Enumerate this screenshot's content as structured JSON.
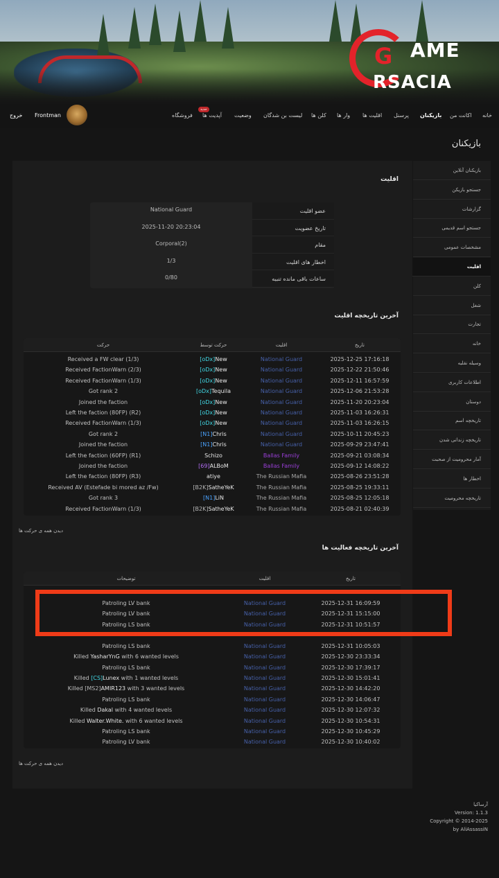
{
  "brand": {
    "logo_line1": "AME",
    "logo_line2": "RSACIA",
    "logo_mark": "G"
  },
  "nav": {
    "items": [
      "خانه",
      "اکانت من",
      "بازیکنان",
      "پرسنل",
      "اقلیت ها",
      "وار ها",
      "کلن ها",
      "لیست بن شدگان",
      "وضعیت",
      "آپدیت ها",
      "فروشگاه"
    ],
    "active": "بازیکنان",
    "badge": "جدید",
    "username": "Frontman",
    "logout": "خروج"
  },
  "page_title": "بازیکنان",
  "sidebar": {
    "items": [
      "بازیکنان آنلاین",
      "جستجو بازیکن",
      "گزارشات",
      "جستجو اسم قدیمی",
      "مشخصات عمومی",
      "اقلیت",
      "کلن",
      "شغل",
      "تجارت",
      "خانه",
      "وسیله نقلیه",
      "اطلاعات کاربری",
      "دوستان",
      "تاریخچه اسم",
      "تاریخچه زندانی شدن",
      "آمار محرومیت از صحبت",
      "اخطار ها",
      "تاریخچه محرومیت"
    ],
    "active_index": 5
  },
  "faction": {
    "title": "اقلیت",
    "rows": [
      {
        "label": "عضو اقلیت",
        "value": "National Guard"
      },
      {
        "label": "تاریخ عضویت",
        "value": "2025-11-20 20:23:04"
      },
      {
        "label": "مقام",
        "value": "Corporal(2)"
      },
      {
        "label": "اخطار های اقلیت",
        "value": "1/3"
      },
      {
        "label": "ساعات باقی مانده تنبیه",
        "value": "0/80"
      }
    ]
  },
  "faction_history": {
    "title": "آخرین تاریخچه اقلیت",
    "headers": {
      "date": "تاریخ",
      "faction": "اقلیت",
      "by": "حرکت توسط",
      "action": "حرکت"
    },
    "rows": [
      {
        "date": "2025-12-25 17:16:18",
        "faction": "National Guard",
        "tag": "[oDx]",
        "name": "New",
        "action": "Received a FW clear (1/3)"
      },
      {
        "date": "2025-12-22 21:50:46",
        "faction": "National Guard",
        "tag": "[oDx]",
        "name": "New",
        "action": "Received FactionWarn (2/3)"
      },
      {
        "date": "2025-12-11 16:57:59",
        "faction": "National Guard",
        "tag": "[oDx]",
        "name": "New",
        "action": "Received FactionWarn (1/3)"
      },
      {
        "date": "2025-12-06 21:53:28",
        "faction": "National Guard",
        "tag": "[oDx]",
        "name": "Tequila",
        "action": "Got rank 2"
      },
      {
        "date": "2025-11-20 20:23:04",
        "faction": "National Guard",
        "tag": "[oDx]",
        "name": "New",
        "action": "Joined the faction"
      },
      {
        "date": "2025-11-03 16:26:31",
        "faction": "National Guard",
        "tag": "[oDx]",
        "name": "New",
        "action": "Left the faction (80FP) (R2)"
      },
      {
        "date": "2025-11-03 16:26:15",
        "faction": "National Guard",
        "tag": "[oDx]",
        "name": "New",
        "action": "Received FactionWarn (1/3)"
      },
      {
        "date": "2025-10-11 20:45:23",
        "faction": "National Guard",
        "tag": "[N1]",
        "name": "Chris",
        "action": "Got rank 2"
      },
      {
        "date": "2025-09-29 23:47:41",
        "faction": "National Guard",
        "tag": "[N1]",
        "name": "Chris",
        "action": "Joined the faction"
      },
      {
        "date": "2025-09-21 03:08:34",
        "faction": "Ballas Family",
        "tag": "",
        "name": "Schizo",
        "action": "Left the faction (60FP) (R1)"
      },
      {
        "date": "2025-09-12 14:08:22",
        "faction": "Ballas Family",
        "tag": "[69]",
        "name": "ALBoM",
        "action": "Joined the faction"
      },
      {
        "date": "2025-08-26 23:51:28",
        "faction": "The Russian Mafia",
        "tag": "",
        "name": "atiye",
        "action": "Left the faction (80FP) (R3)"
      },
      {
        "date": "2025-08-25 19:33:11",
        "faction": "The Russian Mafia",
        "tag": "[B2K]",
        "name": "SatheYeK",
        "action": "Received AV (Estefade bi mored az /Fw)"
      },
      {
        "date": "2025-08-25 12:05:18",
        "faction": "The Russian Mafia",
        "tag": "[N1]",
        "name": "LiN",
        "action": "Got rank 3"
      },
      {
        "date": "2025-08-21 02:40:39",
        "faction": "The Russian Mafia",
        "tag": "[B2K]",
        "name": "SatheYeK",
        "action": "Received FactionWarn (1/3)"
      }
    ],
    "view_all": "دیدن همه ی حرکت ها"
  },
  "activity_history": {
    "title": "آخرین تاریخچه فعالیت ها",
    "headers": {
      "date": "تاریخ",
      "faction": "اقلیت",
      "desc": "توضیحات"
    },
    "rows": [
      {
        "date": "2025-12-31 16:09:59",
        "faction": "National Guard",
        "pre": "",
        "tag": "",
        "name": "",
        "post": "Patroling LV bank"
      },
      {
        "date": "2025-12-31 15:15:00",
        "faction": "National Guard",
        "pre": "",
        "tag": "",
        "name": "",
        "post": "Patroling LV bank"
      },
      {
        "date": "2025-12-31 10:51:57",
        "faction": "National Guard",
        "pre": "",
        "tag": "",
        "name": "",
        "post": "Patroling LS bank"
      },
      {
        "date": "2025-12-31 10:05:03",
        "faction": "National Guard",
        "pre": "",
        "tag": "",
        "name": "",
        "post": "Patroling LS bank"
      },
      {
        "date": "2025-12-30 23:33:34",
        "faction": "National Guard",
        "pre": "Killed ",
        "tag": "",
        "name": "YasharYnG",
        "post": " with 6 wanted levels"
      },
      {
        "date": "2025-12-30 17:39:17",
        "faction": "National Guard",
        "pre": "",
        "tag": "",
        "name": "",
        "post": "Patroling LS bank"
      },
      {
        "date": "2025-12-30 15:01:41",
        "faction": "National Guard",
        "pre": "Killed ",
        "tag": "[CS]",
        "name": "Lunex",
        "post": " with 1 wanted levels"
      },
      {
        "date": "2025-12-30 14:42:20",
        "faction": "National Guard",
        "pre": "Killed ",
        "tag": "[MS2]",
        "name": "AMIR123",
        "post": " with 3 wanted levels"
      },
      {
        "date": "2025-12-30 14:06:47",
        "faction": "National Guard",
        "pre": "",
        "tag": "",
        "name": "",
        "post": "Patroling LS bank"
      },
      {
        "date": "2025-12-30 12:07:32",
        "faction": "National Guard",
        "pre": "Killed ",
        "tag": "",
        "name": "Dakal",
        "post": " with 4 wanted levels"
      },
      {
        "date": "2025-12-30 10:54:31",
        "faction": "National Guard",
        "pre": "Killed ",
        "tag": "",
        "name": "Walter.White.",
        "post": " with 6 wanted levels"
      },
      {
        "date": "2025-12-30 10:45:29",
        "faction": "National Guard",
        "pre": "",
        "tag": "",
        "name": "",
        "post": "Patroling LS bank"
      },
      {
        "date": "2025-12-30 10:40:02",
        "faction": "National Guard",
        "pre": "",
        "tag": "",
        "name": "",
        "post": "Patroling LV bank"
      }
    ],
    "view_all": "دیدن همه ی حرکت ها"
  },
  "footer": {
    "site": "آرساکیا",
    "version": "Version: 1.1.3",
    "copyright": "Copyright © 2014-2025",
    "author": "by AliAssassiN"
  },
  "colors": {
    "accent_red": "#e3232a",
    "highlight_box": "#f03b18",
    "national_guard": "#4660a8",
    "ballas": "#9a3fd8",
    "tag_blue": "#4aa3ff",
    "tag_cyan": "#42d9e6"
  }
}
